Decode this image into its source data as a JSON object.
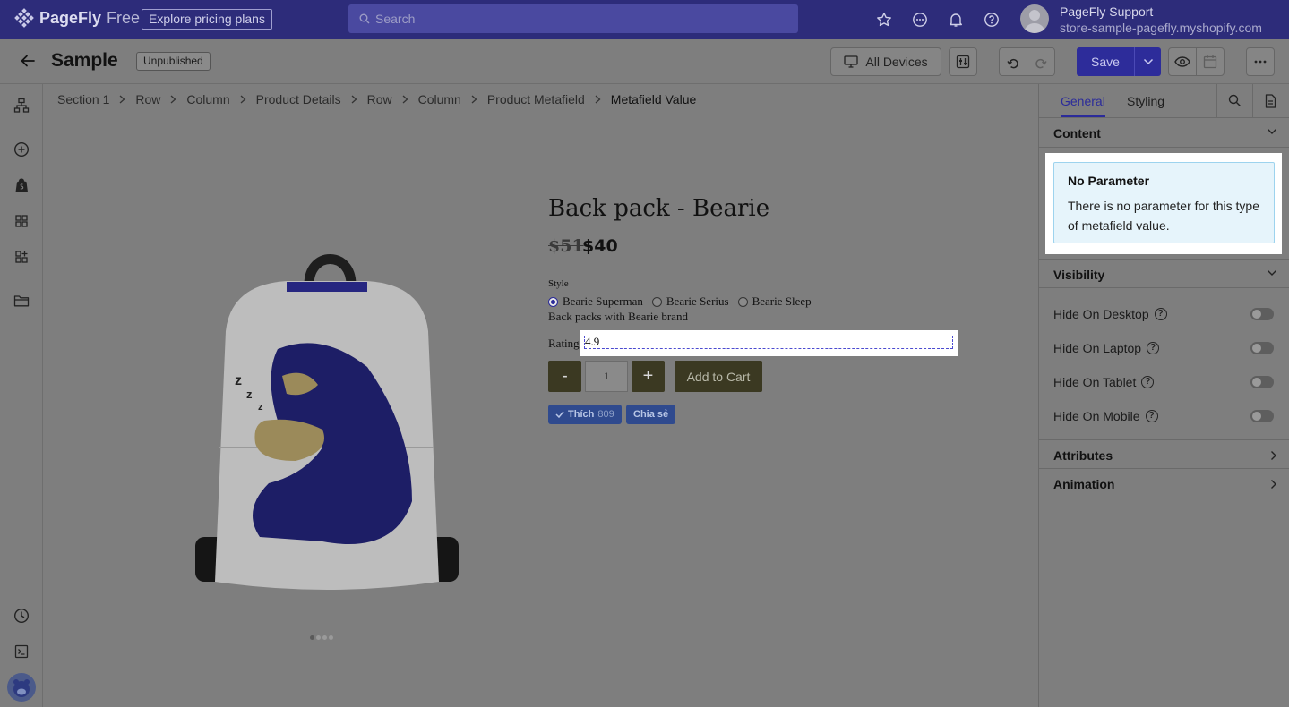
{
  "topbar": {
    "brand": "PageFly",
    "plan": "Free",
    "pricing_link": "Explore pricing plans",
    "search_placeholder": "Search",
    "user_name": "PageFly Support",
    "user_store": "store-sample-pagefly.myshopify.com"
  },
  "editor_bar": {
    "page_title": "Sample",
    "status_badge": "Unpublished",
    "devices_label": "All Devices",
    "save_label": "Save"
  },
  "breadcrumb": [
    "Section 1",
    "Row",
    "Column",
    "Product Details",
    "Row",
    "Column",
    "Product Metafield",
    "Metafield Value"
  ],
  "product": {
    "title": "Back pack - Bearie",
    "old_price": "$51",
    "price": "$40",
    "style_label": "Style",
    "variants": [
      "Bearie Superman",
      "Bearie Serius",
      "Bearie Sleep"
    ],
    "selected_variant": "Bearie Superman",
    "description": "Back packs with Bearie brand",
    "rating_label": "Rating",
    "rating_value": "4.9",
    "qty_minus": "-",
    "qty_value": "1",
    "qty_plus": "+",
    "add_to_cart": "Add to Cart",
    "like_label": "Thích",
    "like_count": "809",
    "share_label": "Chia sẻ",
    "gallery_dots": 4
  },
  "panel": {
    "tabs": [
      "General",
      "Styling"
    ],
    "active_tab": "General",
    "sections": {
      "content": "Content",
      "visibility": "Visibility",
      "attributes": "Attributes",
      "animation": "Animation"
    },
    "notice_title": "No Parameter",
    "notice_body": "There is no parameter for this type of metafield value.",
    "visibility_rows": [
      {
        "label": "Hide On Desktop",
        "on": false
      },
      {
        "label": "Hide On Laptop",
        "on": false
      },
      {
        "label": "Hide On Tablet",
        "on": false
      },
      {
        "label": "Hide On Mobile",
        "on": false
      }
    ]
  },
  "colors": {
    "topbar_bg": "#2d2c7a",
    "accent": "#2d2c9a",
    "overlay_bg": "#7e7e7e",
    "notice_bg": "#e6f4fb",
    "cart_button": "#3b3922"
  }
}
